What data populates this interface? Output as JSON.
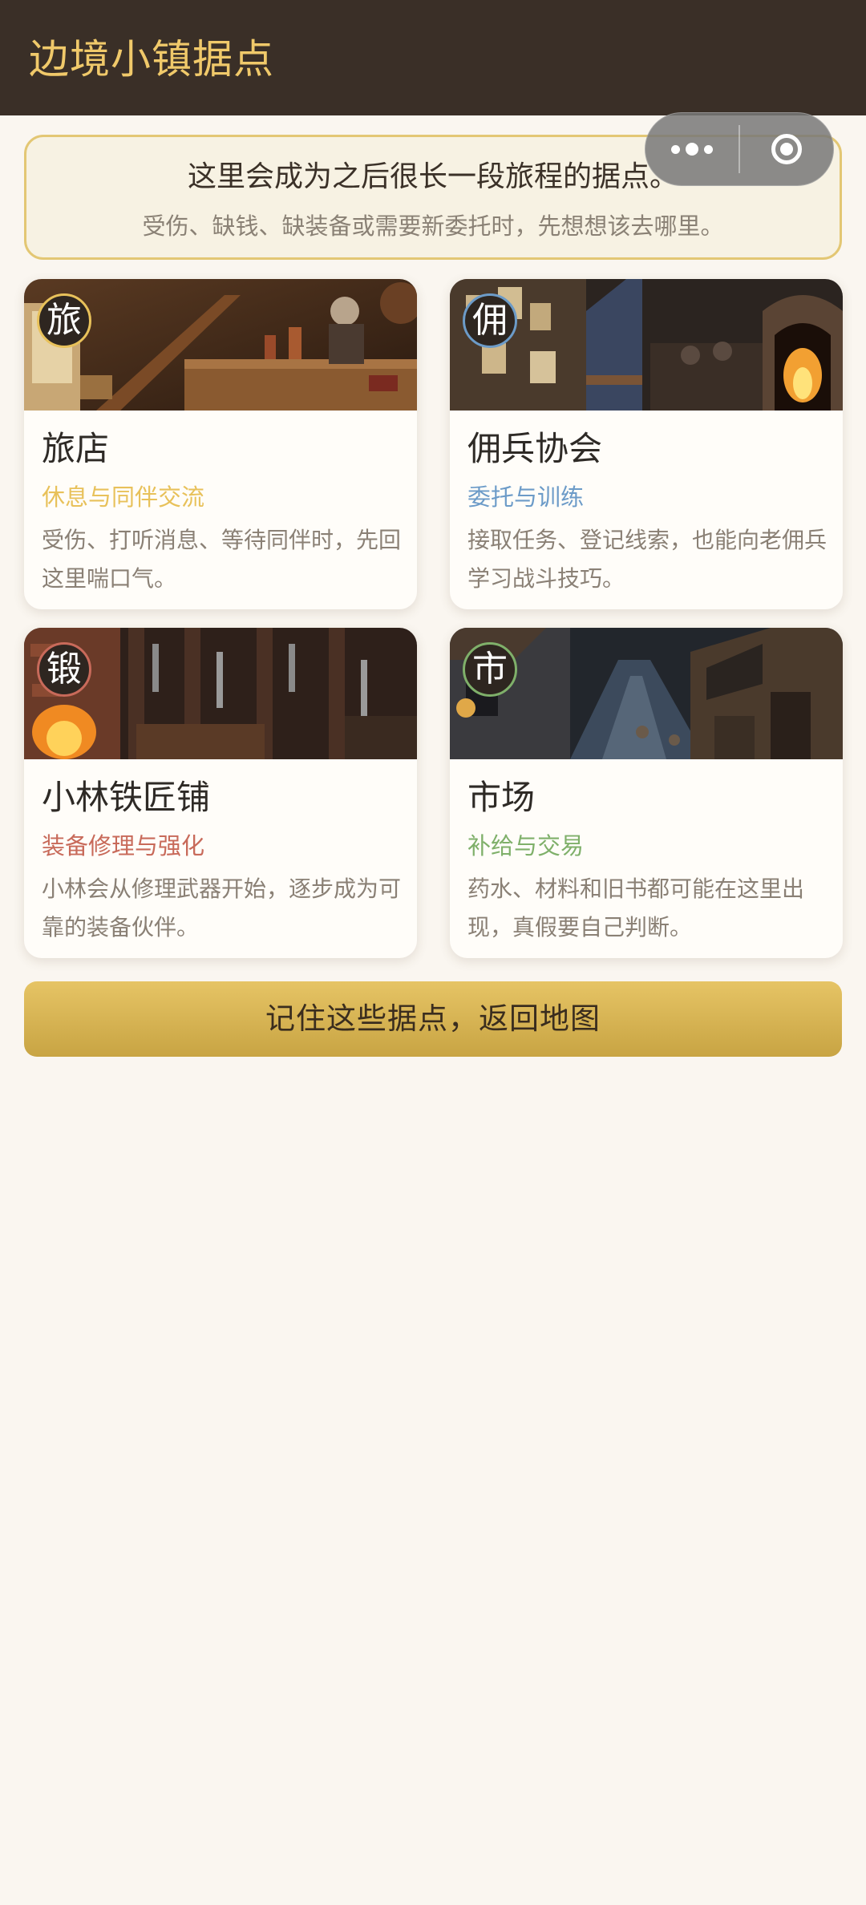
{
  "header": {
    "title": "边境小镇据点"
  },
  "notice": {
    "title": "这里会成为之后很长一段旅程的据点。",
    "text": "受伤、缺钱、缺装备或需要新委托时，先想想该去哪里。"
  },
  "capsule": {
    "more_icon": "more-dots-icon",
    "close_icon": "target-icon"
  },
  "locations": [
    {
      "badge": "旅",
      "name": "旅店",
      "subtitle": "休息与同伴交流",
      "description": "受伤、打听消息、等待同伴时，先回这里喘口气。",
      "accent": "#e8c15a"
    },
    {
      "badge": "佣",
      "name": "佣兵协会",
      "subtitle": "委托与训练",
      "description": "接取任务、登记线索，也能向老佣兵学习战斗技巧。",
      "accent": "#6c9bc8"
    },
    {
      "badge": "锻",
      "name": "小林铁匠铺",
      "subtitle": "装备修理与强化",
      "description": "小林会从修理武器开始，逐步成为可靠的装备伙伴。",
      "accent": "#c86a5a"
    },
    {
      "badge": "市",
      "name": "市场",
      "subtitle": "补给与交易",
      "description": "药水、材料和旧书都可能在这里出现，真假要自己判断。",
      "accent": "#7fb06a"
    }
  ],
  "footer": {
    "button_label": "记住这些据点，返回地图"
  }
}
